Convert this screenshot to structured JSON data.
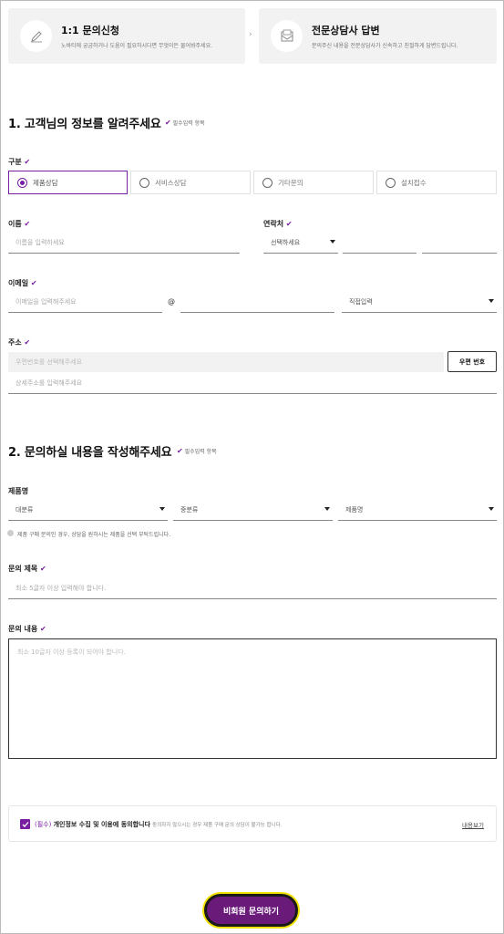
{
  "steps": [
    {
      "title": "1:1 문의신청",
      "desc": "노바티에 궁금하거나 도움이 필요하시다면 무엇이든 물어봐주세요.",
      "icon": "pencil-icon"
    },
    {
      "title": "전문상담사 답변",
      "desc": "문의주신 내용을 전문상담사가 신속하고 친절하게 답변드립니다.",
      "icon": "mail-icon"
    }
  ],
  "section1": {
    "title": "1. 고객님의 정보를 알려주세요",
    "required_note": "필수입력 항목"
  },
  "category": {
    "label": "구분",
    "options": [
      "제품상담",
      "서비스상담",
      "기타문의",
      "설치접수"
    ],
    "selected": "제품상담"
  },
  "name": {
    "label": "이름",
    "placeholder": "이름을 입력하세요"
  },
  "contact": {
    "label": "연락처",
    "select_value": "선택하세요"
  },
  "email": {
    "label": "이메일",
    "placeholder": "이메일을 입력해주세요",
    "at": "@",
    "domain_select": "직접입력"
  },
  "address": {
    "label": "주소",
    "zip_placeholder": "우편번호를 선택해주세요",
    "zip_button": "우편 번호",
    "detail_placeholder": "상세주소를 입력해주세요"
  },
  "section2": {
    "title": "2. 문의하실 내용을 작성해주세요",
    "required_note": "필수입력 항목"
  },
  "product": {
    "label": "제품명",
    "selects": [
      "대분류",
      "중분류",
      "제품명"
    ],
    "note": "제품 구매 문의인 경우, 상담을 원하시는 제품을 선택 부탁드립니다."
  },
  "inquiry_title": {
    "label": "문의 제목",
    "placeholder": "최소 5글자 이상 입력해야 합니다."
  },
  "inquiry_content": {
    "label": "문의 내용",
    "placeholder": "최소 10글자 이상 등록이 되어야 합니다."
  },
  "agreement": {
    "prefix": "(필수)",
    "text": "개인정보 수집 및 이용에 동의합니다",
    "note": "동의하지 않으시는 경우 제품 구매 문의 상담이 불가능 합니다.",
    "link": "내용보기"
  },
  "submit": {
    "label": "비회원 문의하기"
  },
  "colors": {
    "accent": "#7b1fa2",
    "button": "#6a1b7a",
    "focus_ring": "#f2e200"
  }
}
